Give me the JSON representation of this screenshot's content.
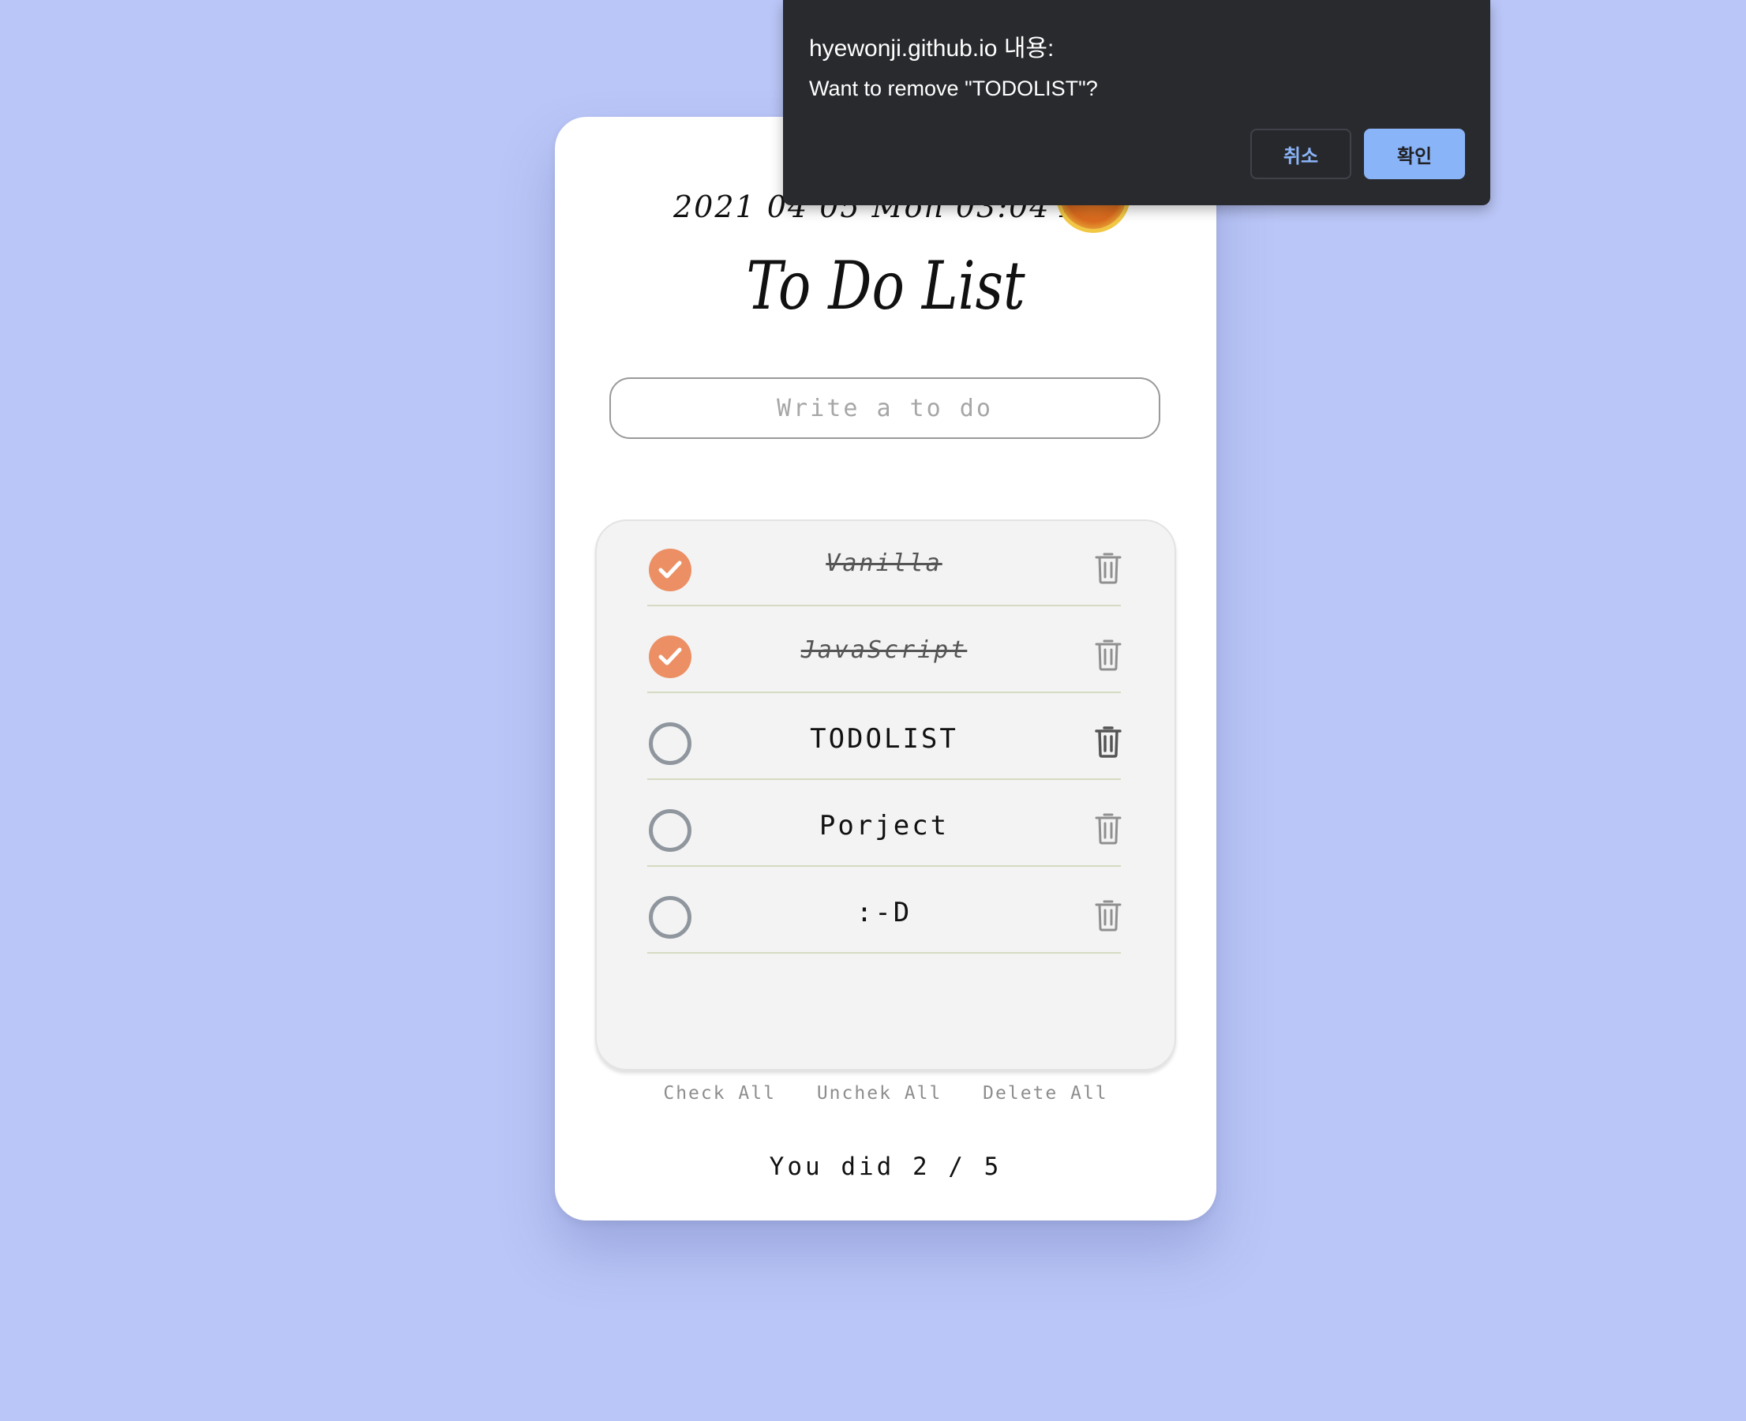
{
  "app": {
    "datetime": "2021 04 05 Mon 03:04 AM",
    "title": "To Do List",
    "input_placeholder": "Write a to do"
  },
  "todos": [
    {
      "text": "Vanilla",
      "done": true
    },
    {
      "text": "JavaScript",
      "done": true
    },
    {
      "text": "TODOLIST",
      "done": false
    },
    {
      "text": "Porject",
      "done": false
    },
    {
      "text": ":-D",
      "done": false
    }
  ],
  "controls": {
    "check_all": "Check All",
    "uncheck_all": "Unchek All",
    "delete_all": "Delete All"
  },
  "summary": "You did 2 / 5",
  "dialog": {
    "title": "hyewonji.github.io 내용:",
    "message": "Want to remove \"TODOLIST\"?",
    "cancel_label": "취소",
    "ok_label": "확인"
  },
  "colors": {
    "background": "#bac6f7",
    "check_done": "#ec8f64",
    "check_open": "#8f969e",
    "dialog_bg": "#292a2e",
    "dialog_ok": "#8ab4f8"
  },
  "icons": {
    "check": "check-icon",
    "trash": "trash-icon",
    "sun": "sun-icon"
  }
}
